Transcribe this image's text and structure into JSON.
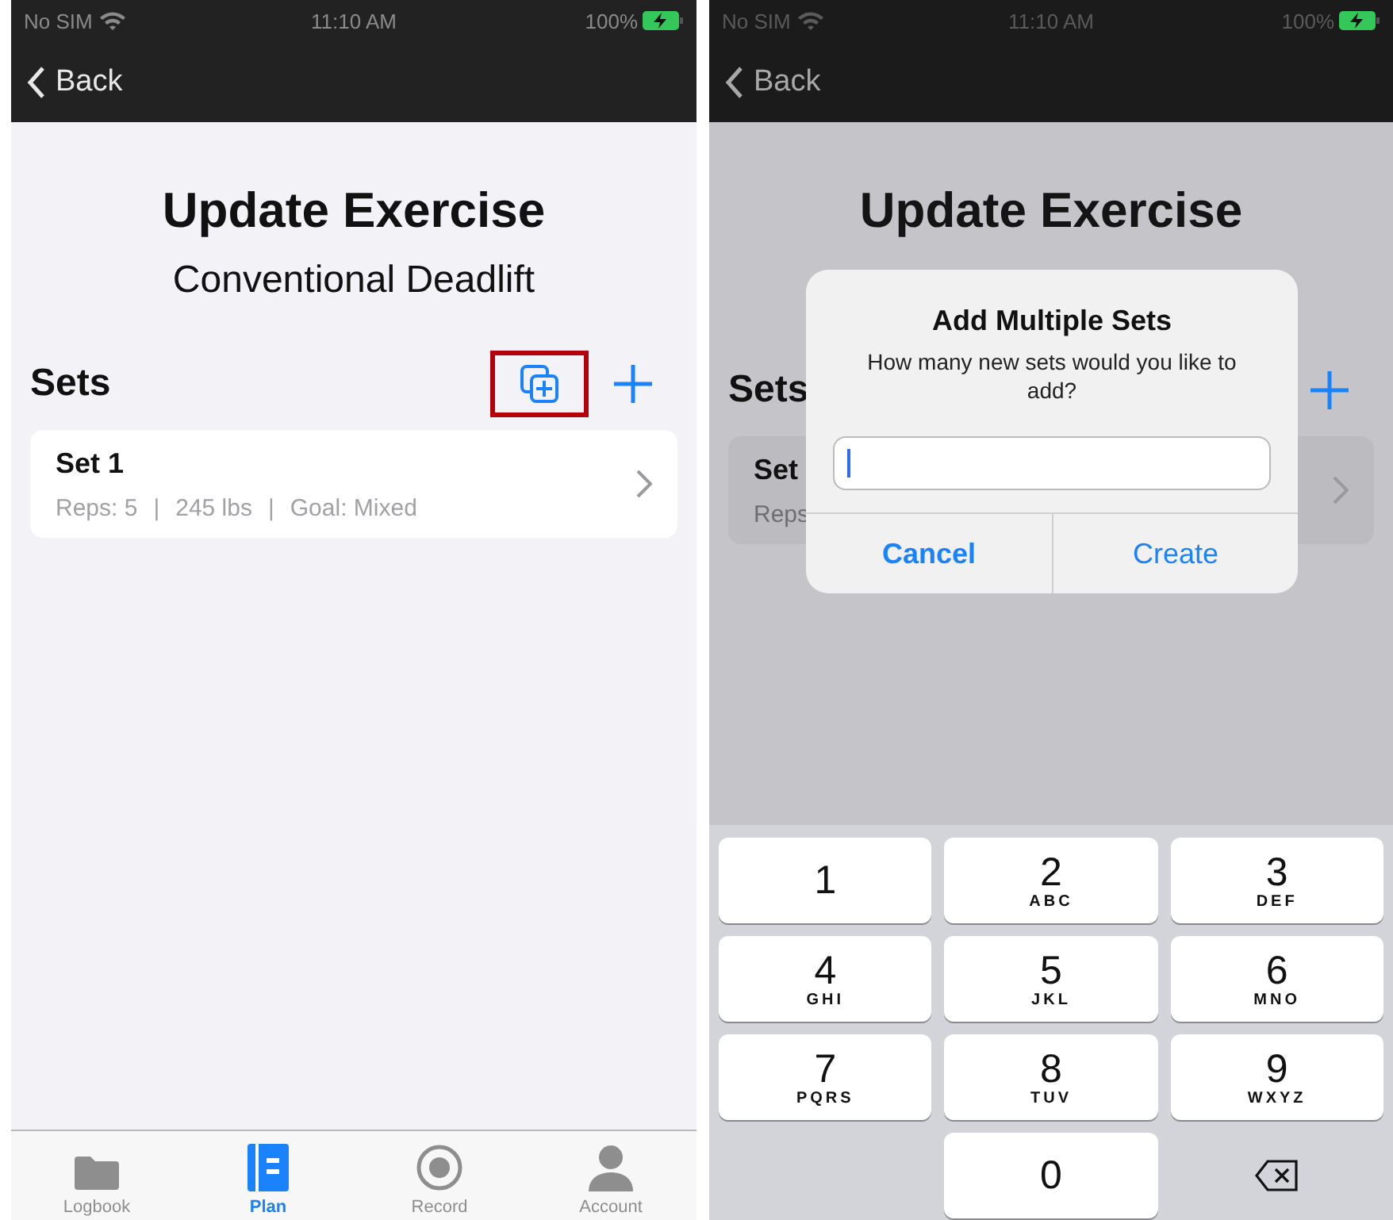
{
  "screens": [
    {
      "dimmed": false,
      "status_bar": {
        "carrier": "No SIM",
        "time": "11:10 AM",
        "battery": "100%"
      },
      "back": "Back",
      "title": "Update Exercise",
      "subtitle": "Conventional Deadlift",
      "sets_label": "Sets",
      "header_buttons": [
        {
          "kind": "duplicate",
          "highlighted": true
        },
        {
          "kind": "add",
          "highlighted": false
        }
      ],
      "sets": [
        {
          "name": "Set 1",
          "details": [
            "Reps: 5",
            "|",
            "245 lbs",
            "|",
            "Goal: Mixed"
          ]
        }
      ],
      "tab_bar": [
        {
          "label": "Logbook",
          "kind": "folder",
          "selected": false
        },
        {
          "label": "Plan",
          "kind": "notebook",
          "selected": true
        },
        {
          "label": "Record",
          "kind": "record",
          "selected": false
        },
        {
          "label": "Account",
          "kind": "person",
          "selected": false
        }
      ]
    },
    {
      "dimmed": true,
      "status_bar": {
        "carrier": "No SIM",
        "time": "11:10 AM",
        "battery": "100%"
      },
      "back": "Back",
      "title": "Update Exercise",
      "sets_label": "Sets",
      "header_buttons": [
        {
          "kind": "add",
          "highlighted": false
        }
      ],
      "sets": [
        {
          "name": "Set",
          "details": [
            "Reps"
          ]
        }
      ],
      "dialog": {
        "title": "Add Multiple Sets",
        "message": "How many new sets would you like to add?",
        "buttons": [
          {
            "label": "Cancel",
            "bold": true
          },
          {
            "label": "Create",
            "bold": false
          }
        ]
      },
      "keyboard": [
        {
          "kind": "digit",
          "digit": "1"
        },
        {
          "kind": "digit",
          "digit": "2",
          "letters": "ABC"
        },
        {
          "kind": "digit",
          "digit": "3",
          "letters": "DEF"
        },
        {
          "kind": "digit",
          "digit": "4",
          "letters": "GHI"
        },
        {
          "kind": "digit",
          "digit": "5",
          "letters": "JKL"
        },
        {
          "kind": "digit",
          "digit": "6",
          "letters": "MNO"
        },
        {
          "kind": "digit",
          "digit": "7",
          "letters": "PQRS"
        },
        {
          "kind": "digit",
          "digit": "8",
          "letters": "TUV"
        },
        {
          "kind": "digit",
          "digit": "9",
          "letters": "WXYZ"
        },
        {
          "kind": "blank"
        },
        {
          "kind": "digit",
          "digit": "0"
        },
        {
          "kind": "delete"
        }
      ]
    }
  ]
}
